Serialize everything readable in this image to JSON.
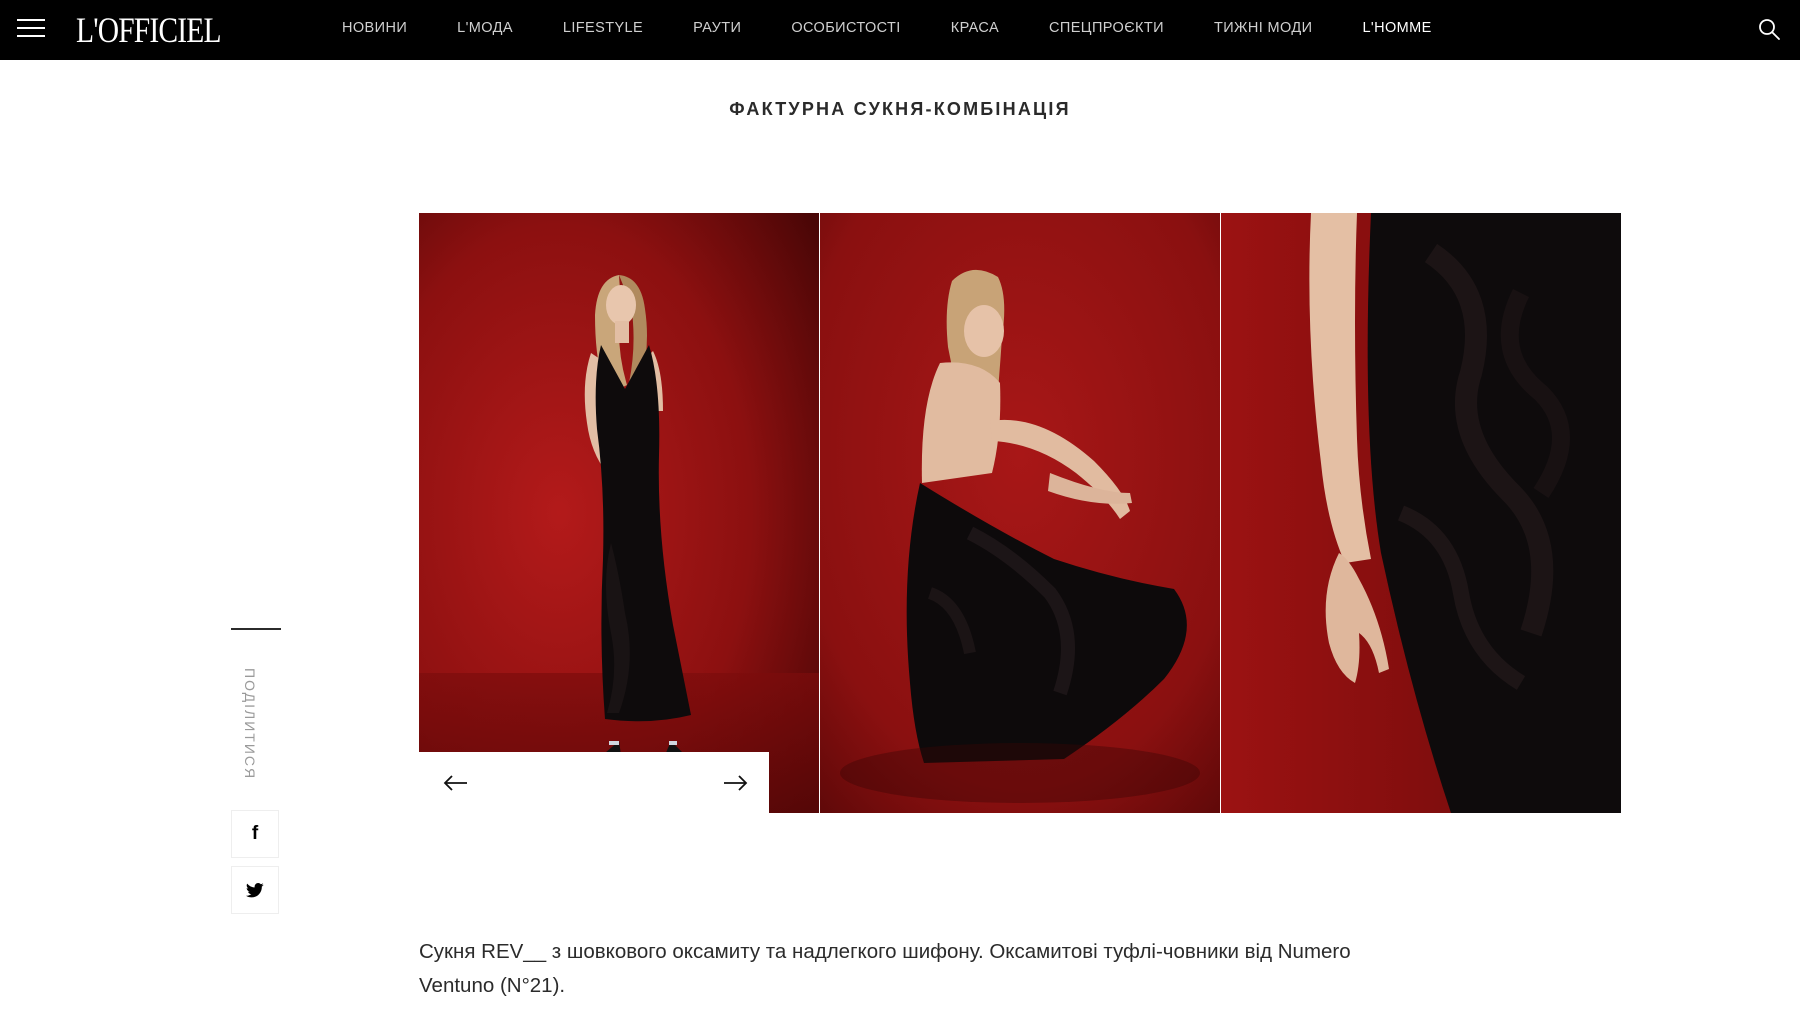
{
  "header": {
    "logo": "L'OFFICIEL",
    "nav": [
      {
        "label": "НОВИНИ"
      },
      {
        "label": "L'МОДА"
      },
      {
        "label": "LIFESTYLE"
      },
      {
        "label": "РАУТИ"
      },
      {
        "label": "ОСОБИСТОСТІ"
      },
      {
        "label": "КРАСА"
      },
      {
        "label": "СПЕЦПРОЄКТИ"
      },
      {
        "label": "ТИЖНІ МОДИ"
      },
      {
        "label": "L'HOMME",
        "active": true
      }
    ],
    "icons": {
      "menu": "hamburger-menu-icon",
      "search": "search-icon"
    }
  },
  "article": {
    "look_title": "ФАКТУРНА СУКНЯ-КОМБІНАЦІЯ",
    "caption": "Сукня REV__ з шовкового оксамиту та надлегкого шифону. Оксамитові туфлі-човники від Numero Ventuno (N°21)."
  },
  "gallery": {
    "photos": [
      {
        "name": "model-standing-full-length-photo"
      },
      {
        "name": "model-crouching-back-view-photo"
      },
      {
        "name": "dress-velvet-detail-closeup-photo"
      }
    ],
    "controls": {
      "prev": "arrow-left-icon",
      "next": "arrow-right-icon"
    }
  },
  "share": {
    "label": "ПОДІЛИТИСЯ",
    "buttons": [
      {
        "network": "facebook",
        "glyph": "f",
        "icon": "facebook-icon"
      },
      {
        "network": "twitter",
        "icon": "twitter-icon"
      }
    ]
  },
  "colors": {
    "nav_background": "#000000",
    "backdrop_red": "#8a1212",
    "text": "#2b2b2b"
  }
}
